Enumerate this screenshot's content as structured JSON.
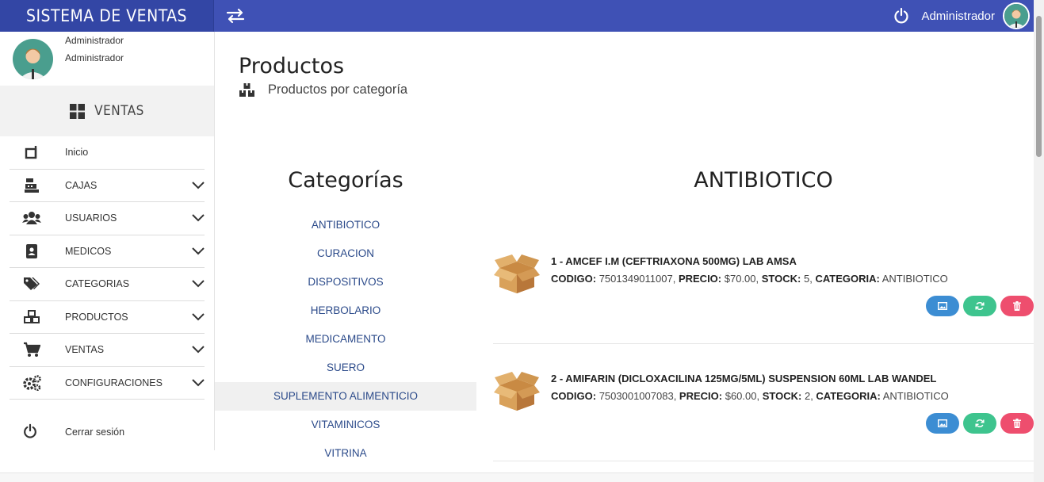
{
  "app": {
    "brand": "SISTEMA DE VENTAS"
  },
  "topbar": {
    "user_name": "Administrador"
  },
  "sidebar": {
    "profile": {
      "name": "Administrador",
      "role": "Administrador"
    },
    "section": "VENTAS",
    "items": [
      {
        "label": "Inicio",
        "icon": "tablet-icon",
        "has_submenu": false
      },
      {
        "label": "CAJAS",
        "icon": "cash-register-icon",
        "has_submenu": true
      },
      {
        "label": "USUARIOS",
        "icon": "users-icon",
        "has_submenu": true
      },
      {
        "label": "MEDICOS",
        "icon": "address-book-icon",
        "has_submenu": true
      },
      {
        "label": "CATEGORIAS",
        "icon": "tags-icon",
        "has_submenu": true
      },
      {
        "label": "PRODUCTOS",
        "icon": "cubes-icon",
        "has_submenu": true
      },
      {
        "label": "VENTAS",
        "icon": "cart-icon",
        "has_submenu": true
      },
      {
        "label": "CONFIGURACIONES",
        "icon": "gears-icon",
        "has_submenu": true
      }
    ],
    "logout": "Cerrar sesión"
  },
  "page": {
    "title": "Productos",
    "subtitle": "Productos por categoría"
  },
  "categories": {
    "title": "Categorías",
    "items": [
      "ANTIBIOTICO",
      "CURACION",
      "DISPOSITIVOS",
      "HERBOLARIO",
      "MEDICAMENTO",
      "SUERO",
      "SUPLEMENTO ALIMENTICIO",
      "VITAMINICOS",
      "VITRINA"
    ],
    "highlighted": "SUPLEMENTO ALIMENTICIO"
  },
  "products": {
    "title": "ANTIBIOTICO",
    "labels": {
      "code": "CODIGO:",
      "price": "PRECIO:",
      "stock": "STOCK:",
      "category": "CATEGORIA:"
    },
    "items": [
      {
        "name": "1 - AMCEF I.M (CEFTRIAXONA 500MG) LAB AMSA",
        "code": "7501349011007",
        "price": "$70.00",
        "stock": "5",
        "category": "ANTIBIOTICO"
      },
      {
        "name": "2 - AMIFARIN (DICLOXACILINA 125MG/5ML) SUSPENSION 60ML LAB WANDEL",
        "code": "7503001007083",
        "price": "$60.00",
        "stock": "2",
        "category": "ANTIBIOTICO"
      }
    ]
  },
  "colors": {
    "topbar": "#3f51b5",
    "brand_bg": "#3346a5",
    "btn_image": "#3c8dd3",
    "btn_update": "#3ec48e",
    "btn_delete": "#ee4e6e",
    "link": "#2b4a8a"
  }
}
